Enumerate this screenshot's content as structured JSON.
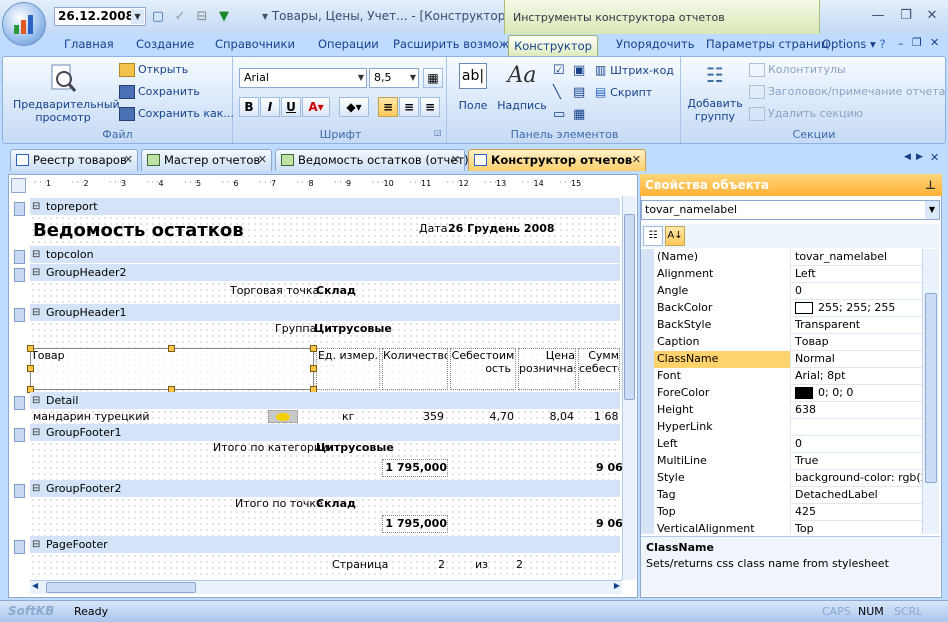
{
  "app": {
    "date": "26.12.2008",
    "window_title": "▾ Товары, Цены, Учет... - [Конструктор о...",
    "context_title": "Инструменты конструктора отчетов"
  },
  "ribbon_tabs": [
    "Главная",
    "Создание",
    "Справочники",
    "Операции",
    "Расширить возможн",
    "Конструктор",
    "Упорядочить",
    "Параметры страниц"
  ],
  "options_label": "Options",
  "ribbon": {
    "file": {
      "label": "Файл",
      "preview": "Предварительный просмотр",
      "preview_line1": "Предварительный",
      "preview_line2": "просмотр",
      "open": "Открыть",
      "save": "Сохранить",
      "save_as": "Сохранить как..."
    },
    "font": {
      "label": "Шрифт",
      "family": "Arial",
      "size": "8,5"
    },
    "elements": {
      "label": "Панель элементов",
      "field": "Поле",
      "caption": "Надпись",
      "barcode": "Штрих-код",
      "script": "Скрипт"
    },
    "sections": {
      "label": "Секции",
      "add_group": "Добавить группу",
      "add_group_line1": "Добавить",
      "add_group_line2": "группу",
      "headers": "Колонтитулы",
      "header_note": "Заголовок/примечание отчета",
      "delete_section": "Удалить секцию"
    }
  },
  "doc_tabs": [
    "Реестр товаров",
    "Мастер отчетов",
    "Ведомость остатков (отчет)",
    "Конструктор отчетов"
  ],
  "ruler_numbers": [
    "1",
    "2",
    "3",
    "4",
    "5",
    "6",
    "7",
    "8",
    "9",
    "10",
    "11",
    "12",
    "13",
    "14",
    "15"
  ],
  "bands": {
    "topreport": "topreport",
    "topcolon": "topcolon",
    "gh2": "GroupHeader2",
    "gh1": "GroupHeader1",
    "detail": "Detail",
    "gf1": "GroupFooter1",
    "gf2": "GroupFooter2",
    "pagefooter": "PageFooter"
  },
  "report": {
    "title": "Ведомость остатков",
    "date_label": "Дата",
    "date_value": "26 Грудень 2008",
    "shop_label": "Торговая точка",
    "shop_value": "Склад",
    "group_label": "Группа",
    "group_value": "Цитрусовые",
    "cols": {
      "product": "Товар",
      "unit": "Ед. измер.",
      "qty": "Количество",
      "cost1": "Себестоим",
      "cost2": "ость",
      "price1": "Цена",
      "price2": "розничная",
      "sum1": "Сумм",
      "sum2": "себесто"
    },
    "row": {
      "product": "мандарин турецкий",
      "unit": "кг",
      "qty": "359",
      "cost": "4,70",
      "price": "8,04",
      "sum": "1 68"
    },
    "cat_total_label": "Итого по категории",
    "cat_total_value": "Цитрусовые",
    "cat_total_sum": "1 795,000",
    "cat_total_sum2": "9 06",
    "shop_total_label": "Итого по точке",
    "shop_total_value": "Склад",
    "shop_total_sum": "1 795,000",
    "shop_total_sum2": "9 06",
    "page_label": "Страница",
    "page_num": "2",
    "of_label": "из",
    "page_total": "2"
  },
  "props": {
    "header": "Свойства объекта",
    "object": "tovar_namelabel",
    "rows": [
      {
        "name": "(Name)",
        "value": "tovar_namelabel"
      },
      {
        "name": "Alignment",
        "value": "Left"
      },
      {
        "name": "Angle",
        "value": "0"
      },
      {
        "name": "BackColor",
        "value": "255; 255; 255",
        "swatch": "#ffffff"
      },
      {
        "name": "BackStyle",
        "value": "Transparent"
      },
      {
        "name": "Caption",
        "value": "Товар"
      },
      {
        "name": "ClassName",
        "value": "Normal"
      },
      {
        "name": "Font",
        "value": "Arial; 8pt"
      },
      {
        "name": "ForeColor",
        "value": "0; 0; 0",
        "swatch": "#000000"
      },
      {
        "name": "Height",
        "value": "638"
      },
      {
        "name": "HyperLink",
        "value": ""
      },
      {
        "name": "Left",
        "value": "0"
      },
      {
        "name": "MultiLine",
        "value": "True"
      },
      {
        "name": "Style",
        "value": "background-color: rgb(255,"
      },
      {
        "name": "Tag",
        "value": "DetachedLabel"
      },
      {
        "name": "Top",
        "value": "425"
      },
      {
        "name": "VerticalAlignment",
        "value": "Top"
      }
    ],
    "selected": "ClassName",
    "desc_title": "ClassName",
    "desc_text": "Sets/returns css class name from stylesheet"
  },
  "status": {
    "brand": "SoftKB",
    "text": "Ready",
    "caps": "CAPS",
    "num": "NUM",
    "scrl": "SCRL"
  }
}
